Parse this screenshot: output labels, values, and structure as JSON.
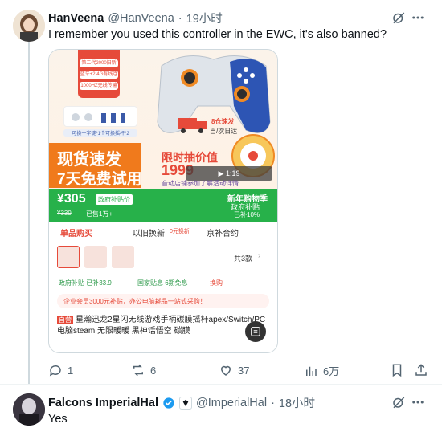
{
  "tweet1": {
    "display_name": "HanVeena",
    "handle": "@HanVeena",
    "sep": "·",
    "time": "19小时",
    "text": "I remember you used this controller in the EWC, it's also banned?",
    "actions": {
      "reply": "1",
      "retweet": "6",
      "like": "37",
      "views": "6万"
    }
  },
  "product": {
    "promo_main": "现货速发",
    "promo_sub": "7天免费试用",
    "limited": "限时抽价值",
    "limited_price": "1999",
    "hot_line": "音动店铺参加了解活动详情",
    "express": "8仓速发",
    "express_sub": "当/次日达",
    "price": "¥305",
    "price_tag": "政府补贴价",
    "orig_price": "¥339",
    "sold": "已售1万+",
    "newyear": "新年购物季",
    "subsidy": "政府补贴",
    "subsidy_pct": "已补10%",
    "tabs": [
      "单品购买",
      "以旧换新",
      "京补合约"
    ],
    "tab_badge": "0元换新",
    "count": "共3款",
    "tags": [
      "政府补贴 已补33.9",
      "国家贴息 6期免息",
      "换购"
    ],
    "notice": "企业会员3000元补贴，办公电脑耗品一站式采购！",
    "title_badge": "自营",
    "title_text": "星瀚迅龙2星闪无线游戏手柄碳膜摇杆apex/Switch/PC电脑steam 无限暖暖 黑神话悟空 碳膜",
    "video_label": "▶ 1:19",
    "small_labels": [
      "第二代2000旧新机",
      "蓝牙+2.4G有线连接",
      "1000HZ无线传输",
      "可换十字键*1个可换摇杆*2"
    ]
  },
  "tweet2": {
    "display_name": "Falcons ImperialHal",
    "handle": "@ImperialHal",
    "sep": "·",
    "time": "18小时",
    "text": "Yes"
  }
}
